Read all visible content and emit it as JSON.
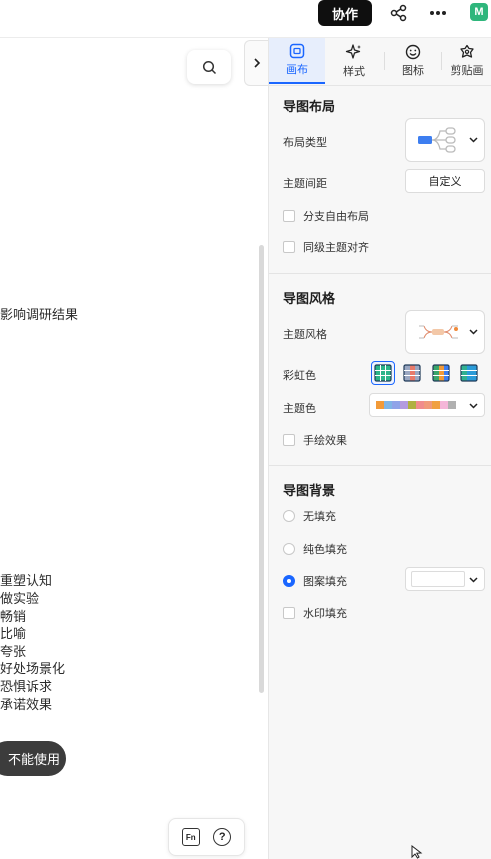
{
  "topbar": {
    "collab_label": "协作",
    "share_icon": "share-nodes-icon",
    "more_icon": "more-dots-icon",
    "app_logo_text": "M"
  },
  "canvas": {
    "nodes_top": "影响调研结果",
    "nodes": [
      "重塑认知",
      "做实验",
      "畅销",
      "比喻",
      "夸张",
      "好处场景化",
      "恐惧诉求",
      "承诺效果"
    ],
    "pill_label": "不能使用",
    "fn_label": "Fn",
    "help_label": "?"
  },
  "panel": {
    "tabs": [
      {
        "label": "画布",
        "icon": "canvas-icon"
      },
      {
        "label": "样式",
        "icon": "sparkle-icon"
      },
      {
        "label": "图标",
        "icon": "smile-icon"
      },
      {
        "label": "剪贴画",
        "icon": "clipart-icon"
      }
    ],
    "layout": {
      "title": "导图布局",
      "layout_type_label": "布局类型",
      "topic_spacing_label": "主题间距",
      "custom_label": "自定义",
      "free_branch_label": "分支自由布局",
      "sibling_align_label": "同级主题对齐"
    },
    "style": {
      "title": "导图风格",
      "theme_style_label": "主题风格",
      "rainbow_label": "彩虹色",
      "theme_color_label": "主题色",
      "hand_drawn_label": "手绘效果",
      "theme_colors": [
        "#f29a38",
        "#7fb5e6",
        "#8fa3e8",
        "#b49be0",
        "#b0b040",
        "#f08c8c",
        "#f09a7a",
        "#f0a040",
        "#f4b6d8",
        "#b0b0b0",
        "#ffffff"
      ]
    },
    "background": {
      "title": "导图背景",
      "no_fill_label": "无填充",
      "solid_fill_label": "纯色填充",
      "pattern_fill_label": "图案填充",
      "watermark_fill_label": "水印填充",
      "selected": "图案填充"
    }
  },
  "colors": {
    "accent": "#1a66ff",
    "topbar_button": "#0f0f0f"
  }
}
